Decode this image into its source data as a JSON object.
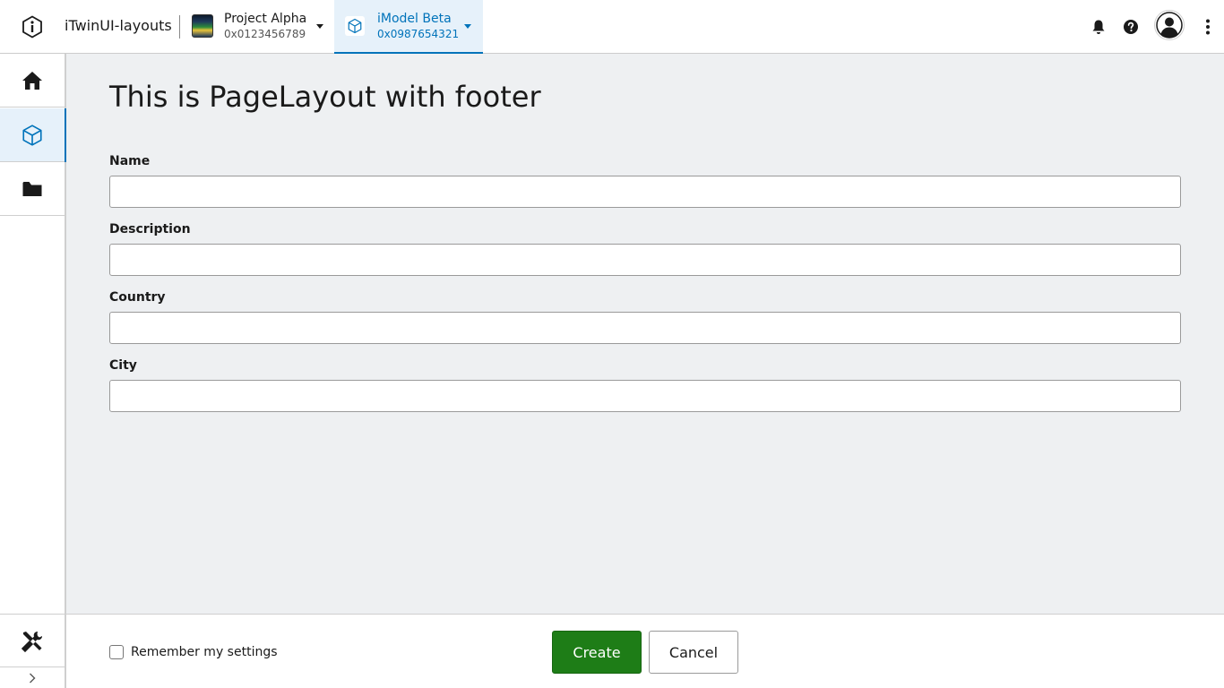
{
  "header": {
    "app_title": "iTwinUI-layouts",
    "project": {
      "name": "Project Alpha",
      "id": "0x0123456789"
    },
    "imodel": {
      "name": "iModel Beta",
      "id": "0x0987654321"
    },
    "icons": [
      "itwin-logo-icon",
      "bell-icon",
      "help-icon",
      "user-avatar-icon",
      "more-vertical-icon"
    ]
  },
  "sidebar": {
    "items": [
      {
        "name": "home",
        "icon": "home-icon",
        "active": false
      },
      {
        "name": "imodel",
        "icon": "cube-icon",
        "active": true
      },
      {
        "name": "documents",
        "icon": "folder-icon",
        "active": false
      }
    ],
    "bottom_items": [
      {
        "name": "settings",
        "icon": "tools-icon"
      }
    ],
    "expand_icon": "chevron-right-icon"
  },
  "main": {
    "title": "This is PageLayout with footer",
    "fields": [
      {
        "label": "Name",
        "value": ""
      },
      {
        "label": "Description",
        "value": ""
      },
      {
        "label": "Country",
        "value": ""
      },
      {
        "label": "City",
        "value": ""
      }
    ]
  },
  "footer": {
    "remember_label": "Remember my settings",
    "remember_checked": false,
    "create_label": "Create",
    "cancel_label": "Cancel"
  },
  "colors": {
    "accent": "#0073ba",
    "accent_bg": "#e6f1fa",
    "primary_button": "#1e7d17",
    "content_bg": "#eef0f2"
  }
}
